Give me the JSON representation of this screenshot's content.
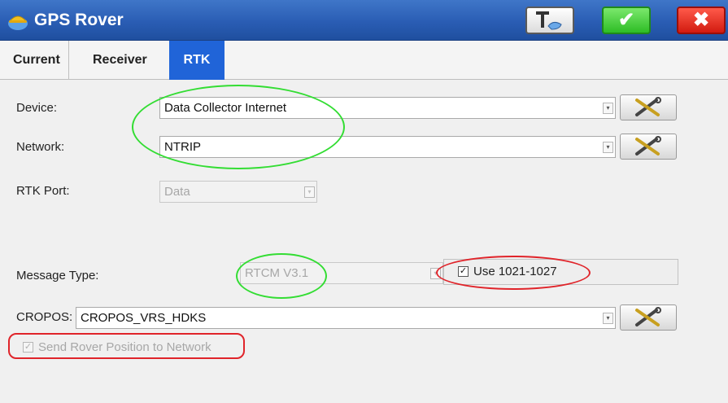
{
  "window": {
    "title": "GPS Rover"
  },
  "tabs": [
    {
      "label": "Current"
    },
    {
      "label": "Receiver"
    },
    {
      "label": "RTK",
      "active": true
    }
  ],
  "form": {
    "device": {
      "label": "Device:",
      "value": "Data Collector Internet"
    },
    "network": {
      "label": "Network:",
      "value": "NTRIP"
    },
    "rtk_port": {
      "label": "RTK Port:",
      "value": "Data",
      "disabled": true
    },
    "message_type": {
      "label": "Message Type:",
      "value": "RTCM V3.1",
      "disabled": true
    },
    "use_1021_1027": {
      "label": "Use 1021-1027",
      "checked": true
    },
    "cropos": {
      "label": "CROPOS:",
      "value": "CROPOS_VRS_HDKS"
    },
    "send_rover_position": {
      "label": "Send Rover Position to Network",
      "checked": true,
      "disabled": true
    }
  },
  "icons": {
    "app": "gps-rover-icon",
    "toolbar_tools": "tools-icon",
    "ok": "checkmark-icon",
    "close": "close-icon",
    "config": "wrench-screwdriver-icon"
  },
  "colors": {
    "titlebar": "#2a5db4",
    "active_tab": "#2064d8",
    "annotation_green": "#33dd33",
    "annotation_red": "#e0242a"
  },
  "glyphs": {
    "ok": "✔",
    "close": "✖",
    "check": "✓",
    "arrow": "▾"
  }
}
